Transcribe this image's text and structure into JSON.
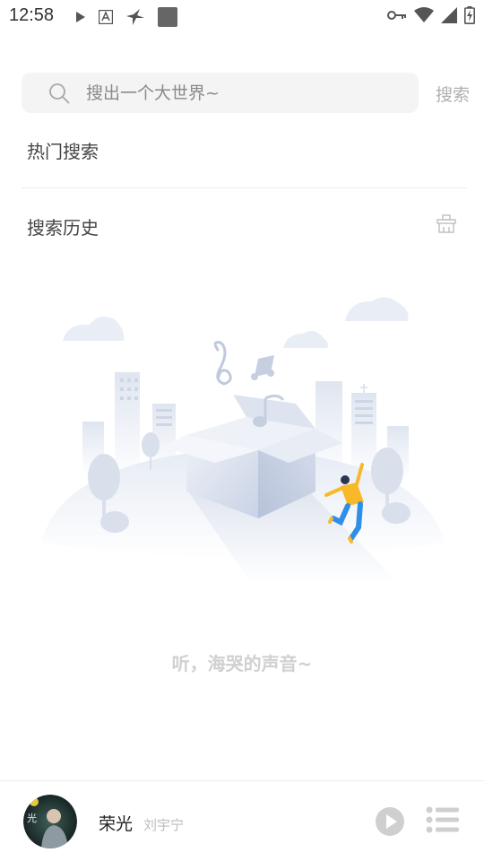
{
  "status_bar": {
    "time": "12:58",
    "left_icons": [
      "play-icon",
      "text-a-icon",
      "bird-icon",
      "square-app-icon"
    ],
    "right_icons": [
      "key-icon",
      "wifi-icon",
      "cell-signal-icon",
      "battery-charging-icon"
    ]
  },
  "search": {
    "placeholder": "搜出一个大世界~",
    "button_label": "搜索"
  },
  "sections": {
    "hot_title": "热门搜索",
    "history_title": "搜索历史"
  },
  "empty_state": {
    "text": "听，海哭的声音~"
  },
  "player": {
    "song_title": "荣光",
    "artist": "刘宇宁",
    "album_text": "光"
  },
  "colors": {
    "search_bg": "#f4f4f4",
    "muted_text": "#b0b0b0",
    "illustration_blue": "#c9d3e6",
    "dancer_yellow": "#f7b928",
    "dancer_blue": "#2f8ee6"
  }
}
